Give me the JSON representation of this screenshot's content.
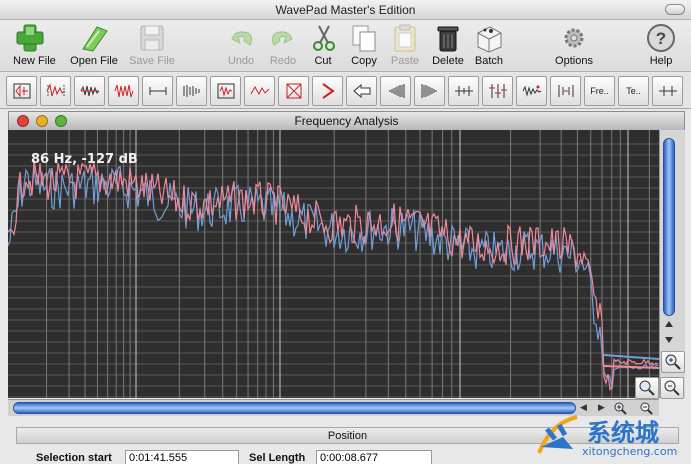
{
  "app": {
    "title": "WavePad Master's Edition"
  },
  "toolbar": {
    "buttons": [
      {
        "label": "New File",
        "icon": "new-file-icon",
        "enabled": true
      },
      {
        "label": "Open File",
        "icon": "open-file-icon",
        "enabled": true
      },
      {
        "label": "Save File",
        "icon": "save-file-icon",
        "enabled": false
      },
      {
        "label": "Undo",
        "icon": "undo-icon",
        "enabled": false
      },
      {
        "label": "Redo",
        "icon": "redo-icon",
        "enabled": false
      },
      {
        "label": "Cut",
        "icon": "scissors-icon",
        "enabled": true
      },
      {
        "label": "Copy",
        "icon": "copy-icon",
        "enabled": true
      },
      {
        "label": "Paste",
        "icon": "paste-icon",
        "enabled": false
      },
      {
        "label": "Delete",
        "icon": "trash-icon",
        "enabled": true
      },
      {
        "label": "Batch",
        "icon": "batch-icon",
        "enabled": true
      },
      {
        "label": "Options",
        "icon": "gear-icon",
        "enabled": true
      },
      {
        "label": "Help",
        "icon": "help-icon",
        "enabled": true
      }
    ]
  },
  "effects_bar": {
    "buttons": [
      {
        "icon": "amplify-icon"
      },
      {
        "icon": "normalize-icon"
      },
      {
        "icon": "envelope-icon"
      },
      {
        "icon": "compress-icon"
      },
      {
        "icon": "silence-icon"
      },
      {
        "icon": "echo-icon"
      },
      {
        "icon": "reverb-icon"
      },
      {
        "icon": "distortion-icon"
      },
      {
        "icon": "fade-in-icon"
      },
      {
        "icon": "fade-out-icon"
      },
      {
        "icon": "reverse-icon"
      },
      {
        "icon": "sweep-up-icon"
      },
      {
        "icon": "sweep-down-icon"
      },
      {
        "icon": "noise-reduction-icon"
      },
      {
        "icon": "eq-icon"
      },
      {
        "icon": "pitch-icon"
      },
      {
        "icon": "speed-icon"
      },
      {
        "icon": "freq-icon",
        "text": "Fre.."
      },
      {
        "icon": "tempo-icon",
        "text": "Te.."
      },
      {
        "icon": "split-icon"
      }
    ]
  },
  "analysis_window": {
    "title": "Frequency Analysis",
    "readout": "86 Hz, -127 dB",
    "colors": {
      "background": "#2e2e2e",
      "channel_left": "#f08a9a",
      "channel_right": "#6fa0d8",
      "grid": "#9a9a9a"
    }
  },
  "position_panel": {
    "header": "Position",
    "selection_start_label": "Selection start",
    "selection_start_value": "0:01:41.555",
    "sel_length_label": "Sel Length",
    "sel_length_value": "0:00:08.677"
  },
  "watermark": {
    "text": "系统城",
    "url": "xitongcheng.com"
  }
}
